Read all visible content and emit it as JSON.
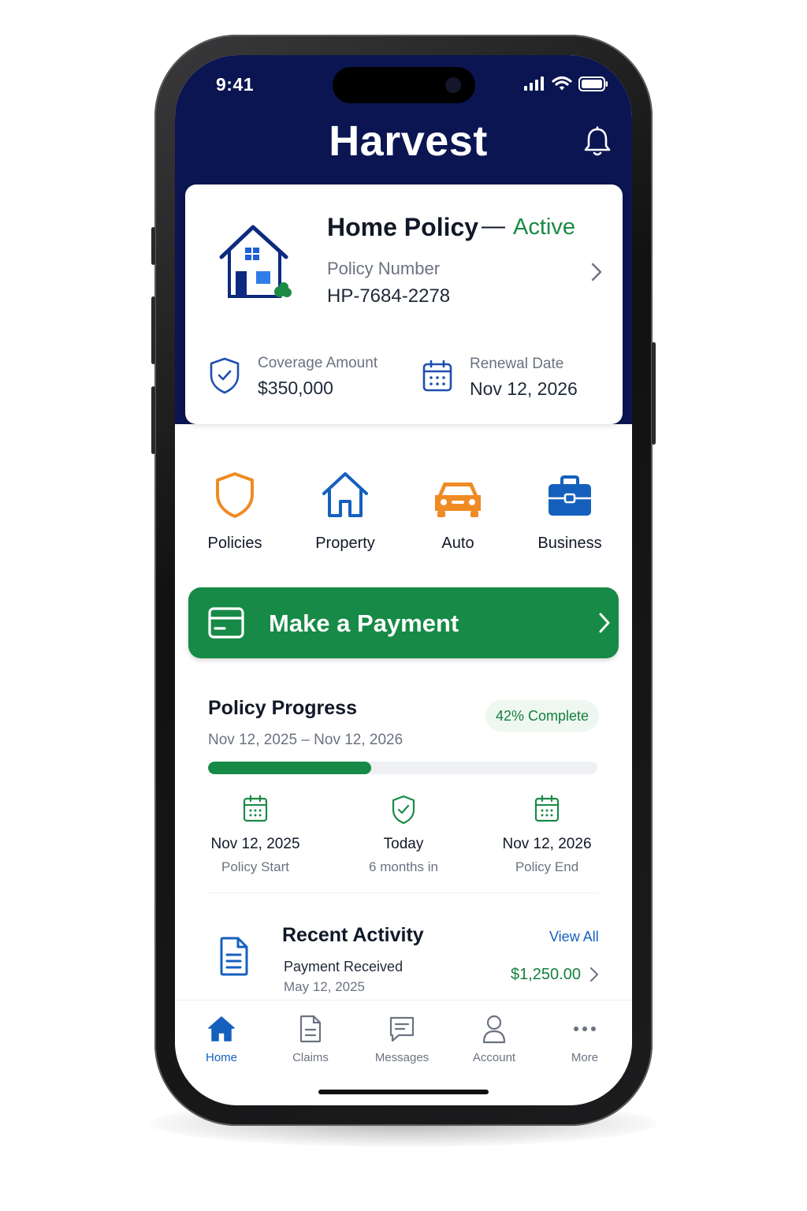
{
  "status_bar": {
    "time": "9:41"
  },
  "header": {
    "title": "Harvest",
    "icons": {
      "bell": "bell-icon"
    }
  },
  "policy_card": {
    "title": "Home Policy",
    "dash": "—",
    "status": "Active",
    "number_label": "Policy Number",
    "number": "HP-7684-2278",
    "coverage_label": "Coverage Amount",
    "coverage_value": "$350,000",
    "renewal_label": "Renewal Date",
    "renewal_value": "Nov 12, 2026"
  },
  "quick_actions": [
    {
      "label": "Policies",
      "icon": "shield-icon"
    },
    {
      "label": "Property",
      "icon": "house-icon"
    },
    {
      "label": "Auto",
      "icon": "car-icon"
    },
    {
      "label": "Business",
      "icon": "briefcase-icon"
    }
  ],
  "payment_button": {
    "label": "Make a Payment",
    "icon": "card-icon"
  },
  "policy_progress": {
    "title": "Policy Progress",
    "range": "Nov 12, 2025 – Nov 12, 2026",
    "badge": "42% Complete",
    "progress_fraction": 0.42,
    "milestones": [
      {
        "date": "Nov 12, 2025",
        "label": "Policy Start",
        "icon": "calendar-icon"
      },
      {
        "date": "Today",
        "label": "6 months in",
        "icon": "shield-check-icon"
      },
      {
        "date": "Nov 12, 2026",
        "label": "Policy End",
        "icon": "calendar-icon"
      }
    ]
  },
  "recent_activity": {
    "title": "Recent Activity",
    "view_all": "View All",
    "item": {
      "title": "Payment Received",
      "date": "May 12, 2025",
      "amount": "$1,250.00"
    }
  },
  "tab_bar": [
    {
      "label": "Home",
      "icon": "home-icon",
      "active": true
    },
    {
      "label": "Claims",
      "icon": "document-icon",
      "active": false
    },
    {
      "label": "Messages",
      "icon": "message-icon",
      "active": false
    },
    {
      "label": "Account",
      "icon": "person-icon",
      "active": false
    },
    {
      "label": "More",
      "icon": "more-icon",
      "active": false
    }
  ],
  "colors": {
    "navy": "#0a1551",
    "green": "#168a46",
    "blue": "#1560bd",
    "orange": "#f08a24"
  }
}
